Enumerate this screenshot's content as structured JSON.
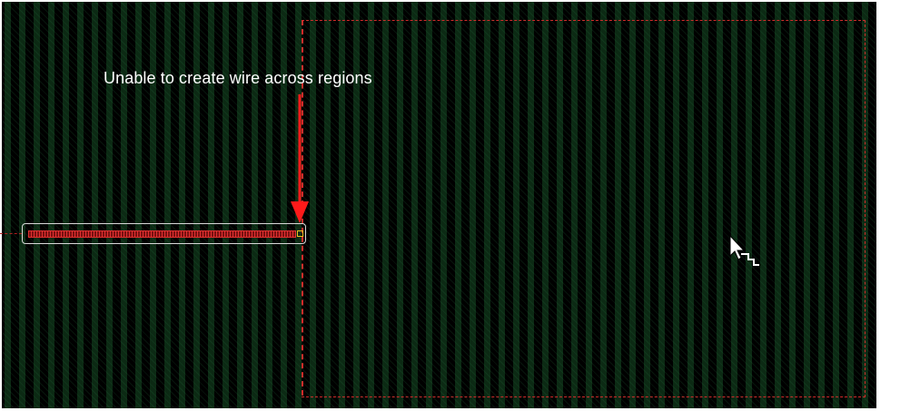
{
  "annotation": {
    "message": "Unable to create wire across regions"
  },
  "colors": {
    "canvas_background": "#000000",
    "track_green": "#1fa050",
    "region_boundary": "#d42a2a",
    "arrow": "#ff1a1a",
    "wire_outline": "#d8d8d8",
    "wire_fill": "#e03030",
    "endpoint_marker": "#f0c020"
  },
  "icons": {
    "cursor": "forbidden-wire-cursor-icon",
    "arrow": "red-down-arrow-icon"
  }
}
